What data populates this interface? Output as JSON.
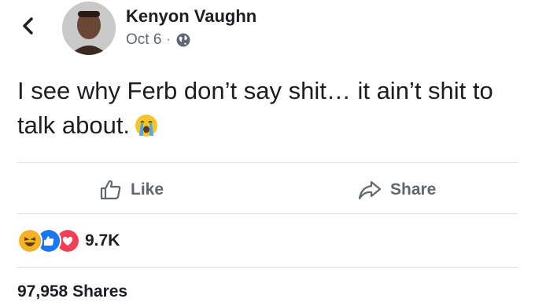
{
  "post": {
    "author": "Kenyon Vaughn",
    "date": "Oct 6",
    "separator": "·",
    "text": "I see why Ferb don’t say shit… it ain’t shit to talk about.",
    "emoji_icon": "loudly-crying-face"
  },
  "actions": {
    "like_label": "Like",
    "share_label": "Share"
  },
  "stats": {
    "reaction_count": "9.7K",
    "reactions": [
      "laughing-face-icon",
      "like-icon",
      "love-icon"
    ],
    "shares": "97,958 Shares"
  },
  "colors": {
    "text": "#1c1e21",
    "secondary": "#606770",
    "divider": "#dadde1",
    "like_blue": "#1877f2",
    "love_red": "#f33e58",
    "haha_yellow": "#f7b125"
  }
}
